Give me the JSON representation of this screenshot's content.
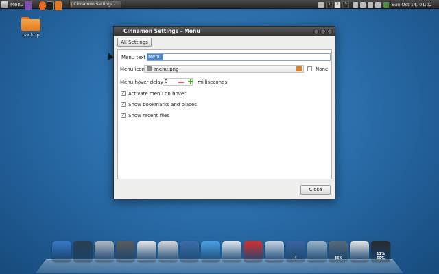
{
  "panel": {
    "menu_label": "Menu",
    "task_title": "Cinnamon Settings - ...",
    "workspaces": [
      "1",
      "2",
      "3"
    ],
    "active_workspace": "2",
    "clock": "Sun Oct 14, 01:02"
  },
  "desktop": {
    "icons": [
      {
        "label": "backup",
        "icon": "folder-icon"
      }
    ]
  },
  "dialog": {
    "title": "Cinnamon Settings - Menu",
    "all_settings_label": "All Settings",
    "menu_text_label": "Menu text",
    "menu_text_value": "Menu",
    "menu_icon_label": "Menu icon",
    "menu_icon_value": "menu.png",
    "none_label": "None",
    "none_checked": false,
    "hover_delay_label": "Menu hover delay",
    "hover_delay_value": "0",
    "hover_delay_unit": "milliseconds",
    "options": [
      {
        "label": "Activate menu on hover",
        "checked": true
      },
      {
        "label": "Show bookmarks and places",
        "checked": true
      },
      {
        "label": "Show recent files",
        "checked": true
      }
    ],
    "close_label": "Close"
  },
  "dock": {
    "items": [
      {
        "name": "finder-icon",
        "color": "#3a78c8"
      },
      {
        "name": "time-machine-icon",
        "color": "#2c3e50"
      },
      {
        "name": "mail-icon",
        "color": "#b0b8c4"
      },
      {
        "name": "calculator-icon",
        "color": "#5a5a5a"
      },
      {
        "name": "text-editor-icon",
        "color": "#e8e8e8"
      },
      {
        "name": "dvd-player-icon",
        "color": "#d8d8d8"
      },
      {
        "name": "preview-icon",
        "color": "#3e6ea8"
      },
      {
        "name": "safari-icon",
        "color": "#4aa0e0"
      },
      {
        "name": "screen-sharing-icon",
        "color": "#e0e8f0"
      },
      {
        "name": "utilities-icon",
        "color": "#d23030"
      },
      {
        "name": "network-icon",
        "color": "#c8d4e4"
      },
      {
        "name": "workspace-switcher-icon",
        "color": "#3c64a0"
      },
      {
        "name": "dashboard-icon",
        "color": "#9cb4c8"
      },
      {
        "name": "trash-icon",
        "color": "#5a6a7a"
      },
      {
        "name": "removable-drive-icon",
        "color": "#e8e8e8"
      },
      {
        "name": "battery-icon",
        "color": "#2a2a2a"
      }
    ],
    "workspace_badge": "2",
    "trash_size": "35K",
    "battery_label": "11%",
    "battery_level": "50%"
  }
}
